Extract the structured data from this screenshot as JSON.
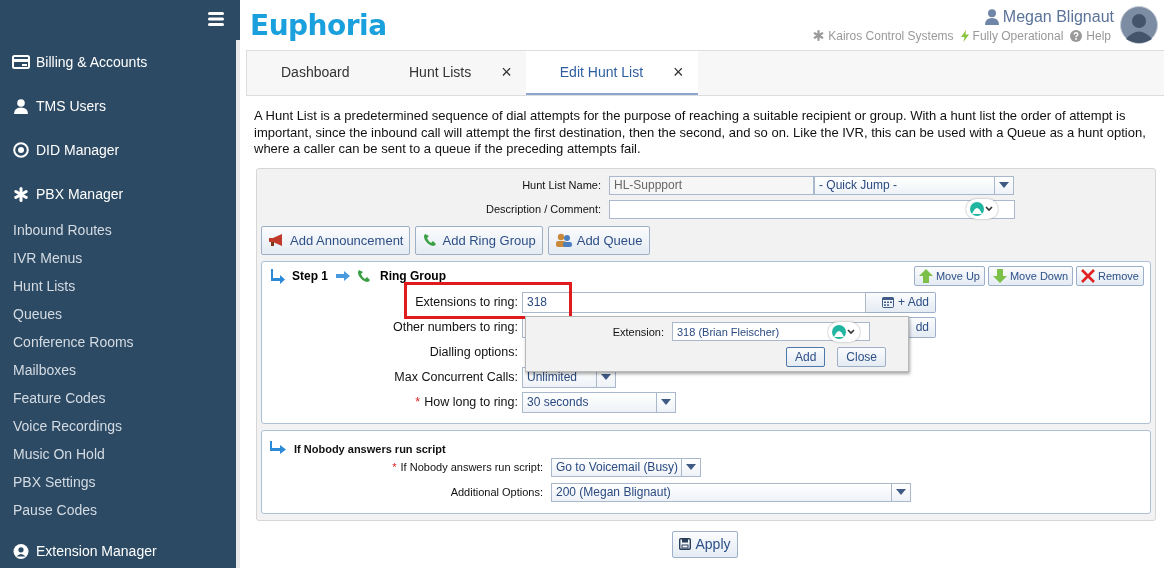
{
  "sidebar": {
    "items": [
      {
        "kind": "section",
        "label": "Billing & Accounts"
      },
      {
        "kind": "section",
        "label": "TMS Users"
      },
      {
        "kind": "section",
        "label": "DID Manager"
      },
      {
        "kind": "section",
        "label": "PBX Manager"
      },
      {
        "kind": "link",
        "label": "Inbound Routes"
      },
      {
        "kind": "link",
        "label": "IVR Menus"
      },
      {
        "kind": "link",
        "label": "Hunt Lists"
      },
      {
        "kind": "link",
        "label": "Queues"
      },
      {
        "kind": "link",
        "label": "Conference Rooms"
      },
      {
        "kind": "link",
        "label": "Mailboxes"
      },
      {
        "kind": "link",
        "label": "Feature Codes"
      },
      {
        "kind": "link",
        "label": "Voice Recordings"
      },
      {
        "kind": "link",
        "label": "Music On Hold"
      },
      {
        "kind": "link",
        "label": "PBX Settings"
      },
      {
        "kind": "link",
        "label": "Pause Codes"
      },
      {
        "kind": "section",
        "label": "Extension Manager"
      }
    ]
  },
  "header": {
    "logo": "Euphoria",
    "user": "Megan Blignaut",
    "company": "Kairos Control Systems",
    "status": "Fully Operational",
    "help": "Help"
  },
  "tabs": [
    {
      "label": "Dashboard",
      "selected": false,
      "closable": false
    },
    {
      "label": "Hunt Lists",
      "selected": false,
      "closable": true
    },
    {
      "label": "Edit Hunt List",
      "selected": true,
      "closable": true
    }
  ],
  "close_glyph": "×",
  "required_mark": "*",
  "description": "A Hunt List is a predetermined sequence of dial attempts for the purpose of reaching a suitable recipient or group. With a hunt list the order of attempt is important, since the inbound call will attempt the first destination, then the second, and so on. Like the IVR, this can be used with a Queue as a hunt option, where a caller can be sent to a queue if the preceding attempts fail.",
  "form": {
    "name_label": "Hunt List Name:",
    "name_value": "HL-Suppport",
    "quick_jump": "- Quick Jump -",
    "comment_label": "Description / Comment:"
  },
  "add_buttons": [
    "Add Announcement",
    "Add Ring Group",
    "Add Queue"
  ],
  "step": {
    "title": "Step 1",
    "type": "Ring Group",
    "actions": [
      "Move Up",
      "Move Down",
      "Remove"
    ],
    "fields": [
      {
        "kind": "input",
        "label": "Extensions to ring:",
        "value": "318",
        "button": "+ Add",
        "required": false,
        "highlighted": true
      },
      {
        "kind": "input",
        "label": "Other numbers to ring:",
        "button": "dd",
        "required": false,
        "highlighted": false
      },
      {
        "kind": "blank",
        "label": "Dialling options:",
        "required": false,
        "highlighted": false
      },
      {
        "kind": "select",
        "label": "Max Concurrent Calls:",
        "value": "Unlimited",
        "required": false,
        "highlighted": false
      },
      {
        "kind": "select",
        "label": "How long to ring:",
        "value": "30 seconds",
        "required": true,
        "highlighted": false
      }
    ]
  },
  "popup": {
    "label": "Extension:",
    "value": "318 (Brian Fleischer)",
    "buttons": [
      "Add",
      "Close"
    ]
  },
  "script": {
    "title": "If Nobody answers run script",
    "fields": [
      {
        "label": "If Nobody answers run script:",
        "value": "Go to Voicemail (Busy)",
        "required": true
      },
      {
        "label": "Additional Options:",
        "value": "200 (Megan Blignaut)",
        "required": false
      }
    ]
  },
  "apply": "Apply"
}
